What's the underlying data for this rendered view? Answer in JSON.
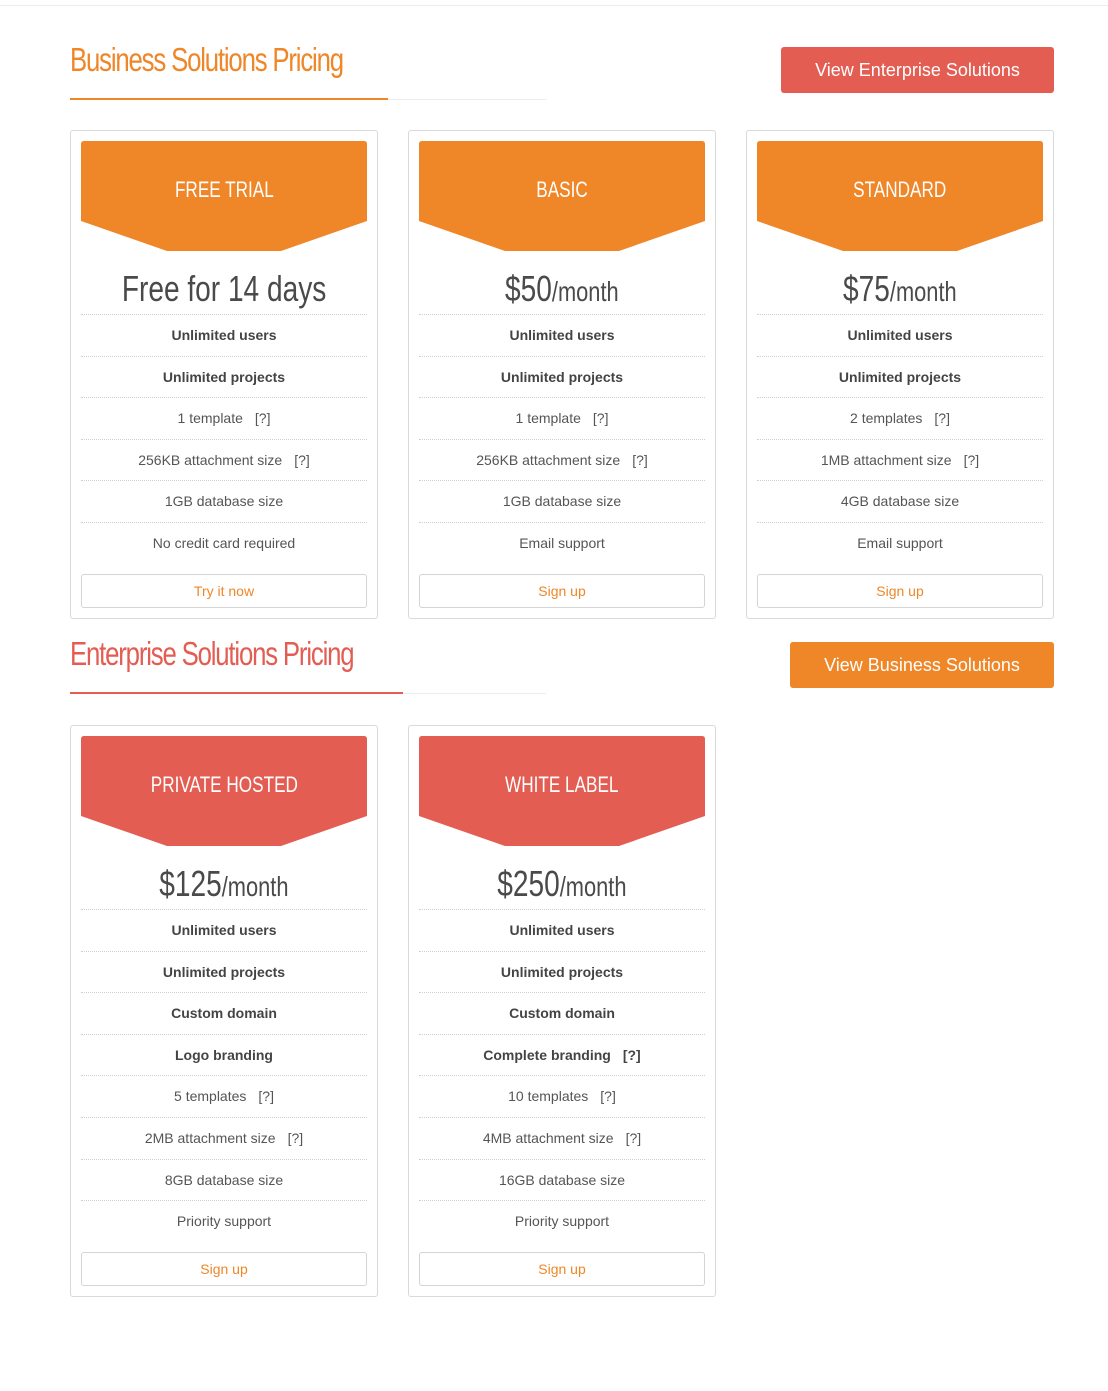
{
  "colors": {
    "business_accent": "#ef8628",
    "enterprise_accent": "#e35d53",
    "text": "#555555"
  },
  "business": {
    "title": "Business Solutions Pricing",
    "switch_button": "View Enterprise Solutions",
    "plans": [
      {
        "name": "FREE TRIAL",
        "price_amount": "Free for 14 days",
        "price_period": "",
        "features": [
          {
            "text": "Unlimited users",
            "bold": true,
            "help": false
          },
          {
            "text": "Unlimited projects",
            "bold": true,
            "help": false
          },
          {
            "text": "1 template",
            "bold": false,
            "help": true
          },
          {
            "text": "256KB attachment size",
            "bold": false,
            "help": true
          },
          {
            "text": "1GB database size",
            "bold": false,
            "help": false
          },
          {
            "text": "No credit card required",
            "bold": false,
            "help": false
          }
        ],
        "cta": "Try it now"
      },
      {
        "name": "BASIC",
        "price_amount": "$50",
        "price_period": "/month",
        "features": [
          {
            "text": "Unlimited users",
            "bold": true,
            "help": false
          },
          {
            "text": "Unlimited projects",
            "bold": true,
            "help": false
          },
          {
            "text": "1 template",
            "bold": false,
            "help": true
          },
          {
            "text": "256KB attachment size",
            "bold": false,
            "help": true
          },
          {
            "text": "1GB database size",
            "bold": false,
            "help": false
          },
          {
            "text": "Email support",
            "bold": false,
            "help": false
          }
        ],
        "cta": "Sign up"
      },
      {
        "name": "STANDARD",
        "price_amount": "$75",
        "price_period": "/month",
        "features": [
          {
            "text": "Unlimited users",
            "bold": true,
            "help": false
          },
          {
            "text": "Unlimited projects",
            "bold": true,
            "help": false
          },
          {
            "text": "2 templates",
            "bold": false,
            "help": true
          },
          {
            "text": "1MB attachment size",
            "bold": false,
            "help": true
          },
          {
            "text": "4GB database size",
            "bold": false,
            "help": false
          },
          {
            "text": "Email support",
            "bold": false,
            "help": false
          }
        ],
        "cta": "Sign up"
      }
    ]
  },
  "enterprise": {
    "title": "Enterprise Solutions Pricing",
    "switch_button": "View Business Solutions",
    "plans": [
      {
        "name": "PRIVATE HOSTED",
        "price_amount": "$125",
        "price_period": "/month",
        "features": [
          {
            "text": "Unlimited users",
            "bold": true,
            "help": false
          },
          {
            "text": "Unlimited projects",
            "bold": true,
            "help": false
          },
          {
            "text": "Custom domain",
            "bold": true,
            "help": false
          },
          {
            "text": "Logo branding",
            "bold": true,
            "help": false
          },
          {
            "text": "5 templates",
            "bold": false,
            "help": true
          },
          {
            "text": "2MB attachment size",
            "bold": false,
            "help": true
          },
          {
            "text": "8GB database size",
            "bold": false,
            "help": false
          },
          {
            "text": "Priority support",
            "bold": false,
            "help": false
          }
        ],
        "cta": "Sign up"
      },
      {
        "name": "WHITE LABEL",
        "price_amount": "$250",
        "price_period": "/month",
        "features": [
          {
            "text": "Unlimited users",
            "bold": true,
            "help": false
          },
          {
            "text": "Unlimited projects",
            "bold": true,
            "help": false
          },
          {
            "text": "Custom domain",
            "bold": true,
            "help": false
          },
          {
            "text": "Complete branding",
            "bold": true,
            "help": true
          },
          {
            "text": "10 templates",
            "bold": false,
            "help": true
          },
          {
            "text": "4MB attachment size",
            "bold": false,
            "help": true
          },
          {
            "text": "16GB database size",
            "bold": false,
            "help": false
          },
          {
            "text": "Priority support",
            "bold": false,
            "help": false
          }
        ],
        "cta": "Sign up"
      }
    ]
  },
  "help_marker": "[?]"
}
